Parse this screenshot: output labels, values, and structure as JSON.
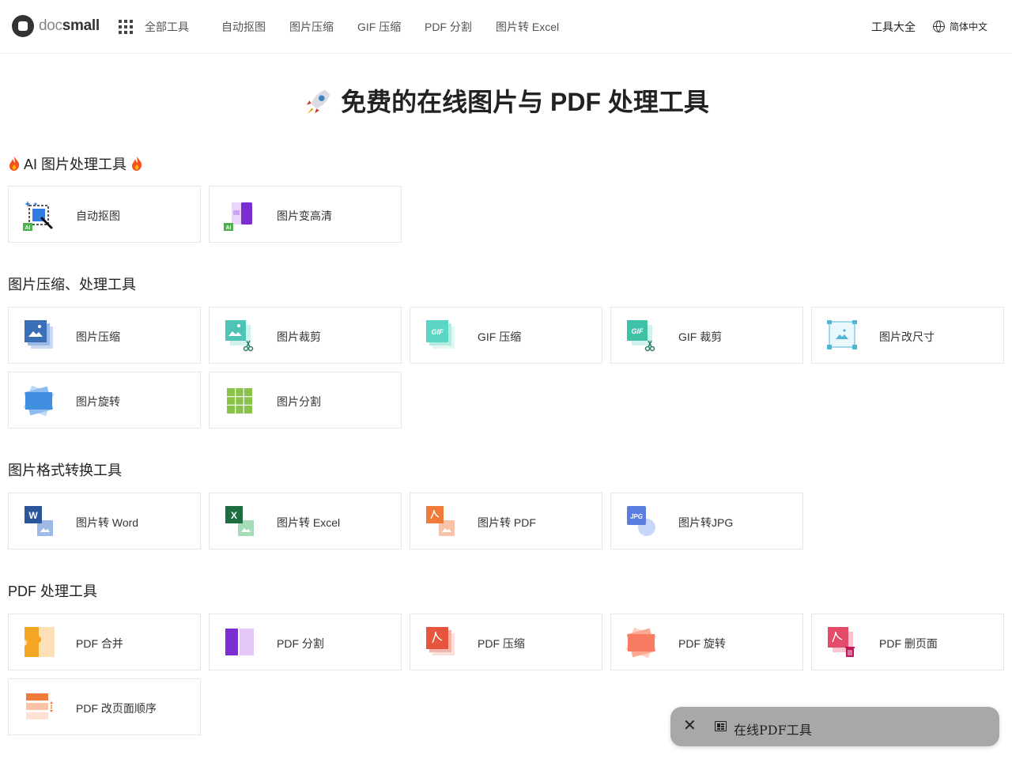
{
  "header": {
    "logo_prefix": "doc",
    "logo_suffix": "small",
    "all_tools": "全部工具",
    "nav": [
      "自动抠图",
      "图片压缩",
      "GIF 压缩",
      "PDF 分割",
      "图片转 Excel"
    ],
    "tools_all": "工具大全",
    "language": "简体中文"
  },
  "page": {
    "title": "免费的在线图片与 PDF 处理工具"
  },
  "sections": {
    "ai": {
      "title": "AI 图片处理工具",
      "items": [
        "自动抠图",
        "图片变高清"
      ]
    },
    "compress": {
      "title": "图片压缩、处理工具",
      "items": [
        "图片压缩",
        "图片裁剪",
        "GIF 压缩",
        "GIF 裁剪",
        "图片改尺寸",
        "图片旋转",
        "图片分割"
      ]
    },
    "convert": {
      "title": "图片格式转换工具",
      "items": [
        "图片转 Word",
        "图片转 Excel",
        "图片转 PDF",
        "图片转JPG"
      ]
    },
    "pdf": {
      "title": "PDF 处理工具",
      "items": [
        "PDF 合并",
        "PDF 分割",
        "PDF 压缩",
        "PDF 旋转",
        "PDF 删页面",
        "PDF 改页面顺序"
      ]
    }
  },
  "float_bar": {
    "label": "在线PDF工具"
  },
  "icon_text": {
    "ai_badge": "AI",
    "gif": "GIF",
    "word": "W",
    "excel": "X",
    "jpg": "JPG"
  },
  "colors": {
    "word": "#2b579a",
    "excel": "#1e6e42",
    "pdf": "#e8553e",
    "image_blue": "#3a6fb5",
    "gif_teal": "#5cd6c4",
    "split_green": "#8bc34a",
    "purple": "#7b2fd1",
    "orange": "#f5a623"
  }
}
